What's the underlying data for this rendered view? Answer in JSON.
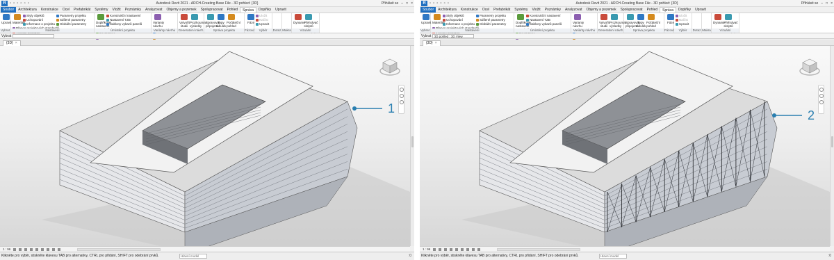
{
  "windows": [
    {
      "title": "Autodesk Revit 2021 - ARCH-Creating Base File - 3D pohled: {3D}",
      "user": "Přihlásit se",
      "tabs": [
        "Soubor",
        "Architektura",
        "Konstrukce",
        "Ocel",
        "Prefabrikát",
        "Systémy",
        "Vložit",
        "Poznámky",
        "Analyzovat",
        "Objemy a pozemek",
        "Spolupracovat",
        "Pohled",
        "Správa",
        "Doplňky",
        "Upravit"
      ],
      "active_tab": "Správa",
      "panels": [
        {
          "title": "Vybrat",
          "big": [
            "Upravit"
          ],
          "small": []
        },
        {
          "title": "Nastavení",
          "big": [
            "Materiály"
          ],
          "small": [
            "Styly objektů",
            "Uchopování",
            "Informace o projektu",
            "Parametry projektu",
            "Sdílené parametry",
            "Globální parametry",
            "Přenos projektových standardů",
            "Vyčistit nepoužité",
            "Jednotky projektu"
          ]
        },
        {
          "title": "Umístění projektu",
          "big": [
            "Doplňkové nastavení"
          ],
          "small": [
            "Konstrukční nastavení",
            "Nastavení TZB",
            "Šablony vykazů panelů",
            "Umístění",
            "Souřadnice",
            "Poloha"
          ]
        },
        {
          "title": "Varianty návrhu",
          "big": [
            "Varianty návrhu"
          ],
          "small": [
            "Přidat do sady",
            "Vybrat aktivní",
            "Hlavní model"
          ]
        },
        {
          "title": "Generativní návrh",
          "big": [
            "Vytvořit studii",
            "Prozkoumat výsledky"
          ],
          "small": []
        },
        {
          "title": "Správa projektu",
          "big": [
            "Spravovat připojené soubory",
            "Typy tabulek",
            "Počáteční pohled"
          ],
          "small": []
        },
        {
          "title": "Fázování",
          "big": [
            "Fáze"
          ],
          "small": []
        },
        {
          "title": "Výběr",
          "big": [],
          "small": [
            "Uložit",
            "Načíst",
            "Upravit"
          ]
        },
        {
          "title": "Dotaz",
          "big": [],
          "small": []
        },
        {
          "title": "Makra",
          "big": [],
          "small": []
        },
        {
          "title": "Vizuální programování",
          "big": [
            "Dynamo",
            "Přehrávač skriptů Dynamo"
          ],
          "small": []
        }
      ],
      "properties_label": "Vybrat",
      "properties_select": "",
      "view_tab": "{3D}",
      "callout": "1",
      "view_scale": "1 : 96",
      "status": "Klikněte pro výběr, stiskněte klávesu TAB pro alternativy, CTRL pro přidání, SHIFT pro odebrání prvků.",
      "status_model": "Hlavní model",
      "status_right": ":0"
    },
    {
      "title": "Autodesk Revit 2021 - ARCH-Creating Base File - 3D pohled: {3D}",
      "user": "Přihlásit se",
      "tabs": [
        "Soubor",
        "Architektura",
        "Konstrukce",
        "Ocel",
        "Prefabrikát",
        "Systémy",
        "Vložit",
        "Poznámky",
        "Analyzovat",
        "Objemy a pozemek",
        "Spolupracovat",
        "Pohled",
        "Správa",
        "Doplňky",
        "Upravit"
      ],
      "active_tab": "Správa",
      "panels": [
        {
          "title": "Vybrat",
          "big": [
            "Upravit"
          ],
          "small": []
        },
        {
          "title": "Nastavení",
          "big": [
            "Materiály"
          ],
          "small": [
            "Styly objektů",
            "Uchopování",
            "Informace o projektu",
            "Parametry projektu",
            "Sdílené parametry",
            "Globální parametry",
            "Přenos projektových standardů",
            "Vyčistit nepoužité",
            "Jednotky projektu"
          ]
        },
        {
          "title": "Umístění projektu",
          "big": [
            "Doplňkové nastavení"
          ],
          "small": [
            "Konstrukční nastavení",
            "Nastavení TZB",
            "Šablony vykazů panelů",
            "Umístění",
            "Souřadnice",
            "Poloha"
          ]
        },
        {
          "title": "Varianty návrhu",
          "big": [
            "Varianty návrhu"
          ],
          "small": [
            "Přidat do sady",
            "Vybrat aktivní",
            "Hlavní model"
          ]
        },
        {
          "title": "Generativní návrh",
          "big": [
            "Vytvořit studii",
            "Prozkoumat výsledky"
          ],
          "small": []
        },
        {
          "title": "Správa projektu",
          "big": [
            "Spravovat připojené soubory",
            "Typy tabulek",
            "Počáteční pohled"
          ],
          "small": []
        },
        {
          "title": "Fázování",
          "big": [
            "Fáze"
          ],
          "small": []
        },
        {
          "title": "Výběr",
          "big": [],
          "small": [
            "Uložit",
            "Načíst",
            "Upravit"
          ]
        },
        {
          "title": "Dotaz",
          "big": [],
          "small": []
        },
        {
          "title": "Makra",
          "big": [],
          "small": []
        },
        {
          "title": "Vizuální programování",
          "big": [
            "Dynamo",
            "Přehrávač skriptů Dynamo"
          ],
          "small": []
        }
      ],
      "properties_label": "Vybrat",
      "properties_select": "3D pohled : 3D View",
      "view_tab": "{3D}",
      "callout": "2",
      "view_scale": "1 : 96",
      "status": "Klikněte pro výběr, stiskněte klávesu TAB pro alternativy, CTRL pro přidání, SHIFT pro odebrání prvků.",
      "status_model": "Hlavní model",
      "status_right": ":0"
    }
  ],
  "colors": {
    "accent": "#1f6fc0",
    "callout": "#2a7fb0",
    "facade": "#c8ccd3",
    "roof": "#f2f2f2"
  }
}
